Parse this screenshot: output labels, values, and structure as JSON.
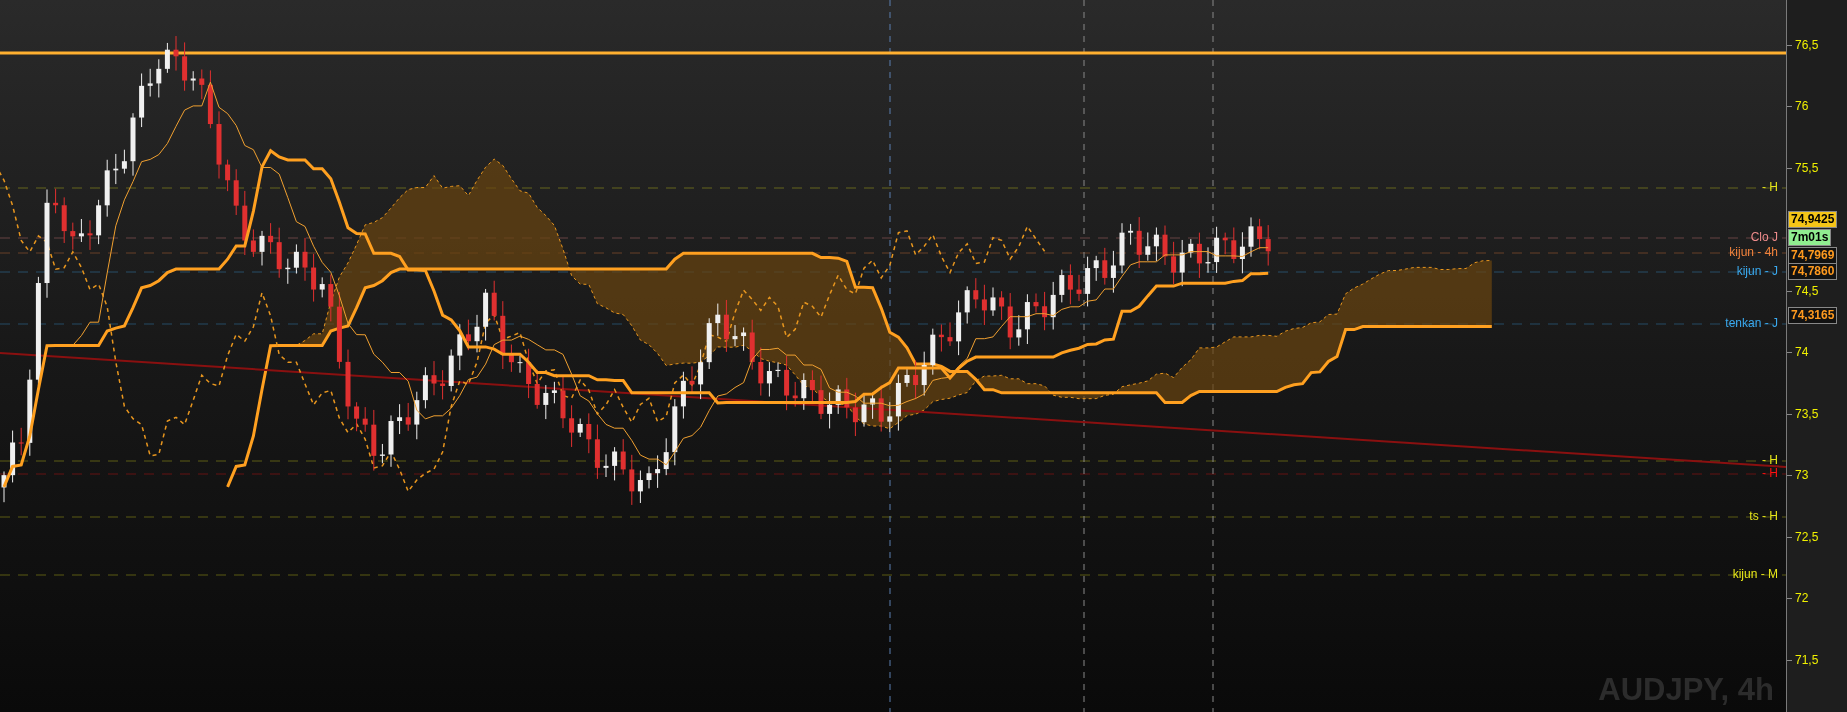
{
  "chart": {
    "symbol": "AUDJPY, 4h",
    "y_axis": [
      "76,5",
      "76",
      "75,5",
      "74,5",
      "74",
      "73,5",
      "73",
      "72,5",
      "72",
      "71,5"
    ],
    "price_tags": [
      {
        "text": "74,9425",
        "kind": "last"
      },
      {
        "text": "7m01s",
        "kind": "timer"
      },
      {
        "text": "74,7969",
        "kind": "level"
      },
      {
        "text": "74,7860",
        "kind": "level"
      },
      {
        "text": "74,3165",
        "kind": "level"
      }
    ],
    "line_labels": [
      {
        "text": "- H",
        "color": "#e6e619"
      },
      {
        "text": "Clo J",
        "color": "#f08c8c"
      },
      {
        "text": "kijun - 4h",
        "color": "#f0823c"
      },
      {
        "text": "kijun - J",
        "color": "#3aaaf0"
      },
      {
        "text": "tenkan - J",
        "color": "#3aaaf0"
      },
      {
        "text": "- H",
        "color": "#e6e619"
      },
      {
        "text": "- H",
        "color": "#ff1010"
      },
      {
        "text": "ts - H",
        "color": "#e6e619"
      },
      {
        "text": "kijun - M",
        "color": "#e6e619"
      }
    ]
  }
}
